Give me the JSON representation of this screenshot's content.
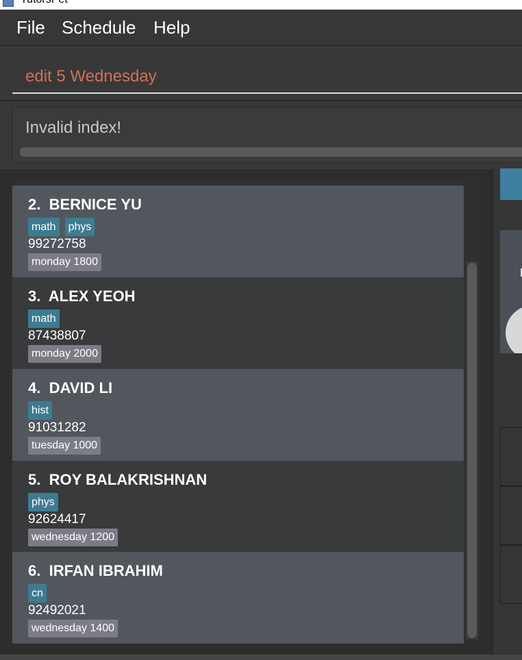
{
  "window": {
    "title": "TutorsPet"
  },
  "menu": {
    "file": "File",
    "schedule": "Schedule",
    "help": "Help"
  },
  "command": {
    "value": "edit 5 Wednesday"
  },
  "result": {
    "message": "Invalid index!"
  },
  "students": [
    {
      "index": "2.",
      "name": "BERNICE YU",
      "tags": [
        "math",
        "phys"
      ],
      "phone": "99272758",
      "schedule": "monday 1800"
    },
    {
      "index": "3.",
      "name": "ALEX YEOH",
      "tags": [
        "math"
      ],
      "phone": "87438807",
      "schedule": "monday 2000"
    },
    {
      "index": "4.",
      "name": "DAVID LI",
      "tags": [
        "hist"
      ],
      "phone": "91031282",
      "schedule": "tuesday 1000"
    },
    {
      "index": "5.",
      "name": "ROY BALAKRISHNAN",
      "tags": [
        "phys"
      ],
      "phone": "92624417",
      "schedule": "wednesday 1200"
    },
    {
      "index": "6.",
      "name": "IRFAN IBRAHIM",
      "tags": [
        "cn"
      ],
      "phone": "92492021",
      "schedule": "wednesday 1400"
    }
  ]
}
